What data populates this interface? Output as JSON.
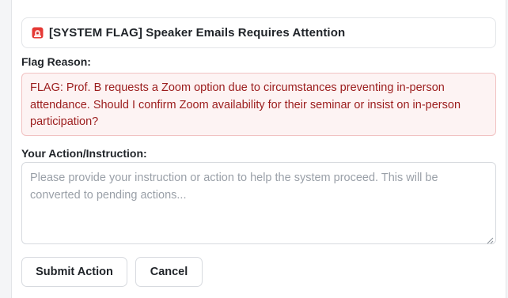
{
  "dialog": {
    "title": "[SYSTEM FLAG] Speaker Emails Requires Attention",
    "title_icon": "siren-icon",
    "accent_color": "#d93025"
  },
  "flag": {
    "label": "Flag Reason:",
    "text": "FLAG: Prof. B requests a Zoom option due to circumstances preventing in-person attendance. Should I confirm Zoom availability for their seminar or insist on in-person participation?",
    "text_color": "#9b1c1c"
  },
  "action": {
    "label": "Your Action/Instruction:",
    "value": "",
    "placeholder": "Please provide your instruction or action to help the system proceed. This will be converted to pending actions..."
  },
  "buttons": {
    "submit_label": "Submit Action",
    "cancel_label": "Cancel"
  }
}
